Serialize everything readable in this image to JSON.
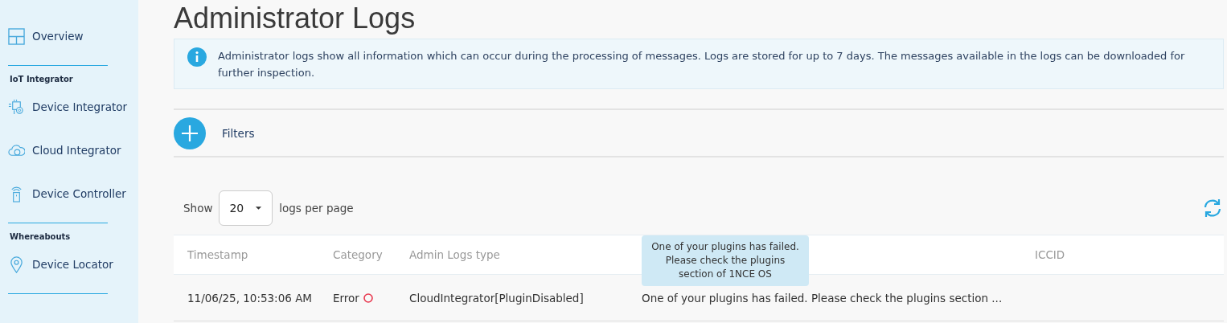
{
  "sidebar": {
    "items": [
      {
        "kind": "link",
        "label": "Overview",
        "selected": false
      },
      {
        "kind": "divider"
      },
      {
        "kind": "section",
        "label": "IoT Integrator"
      },
      {
        "kind": "link",
        "label": "Device Integrator",
        "selected": false
      },
      {
        "kind": "link",
        "label": "Cloud Integrator",
        "selected": false
      },
      {
        "kind": "link",
        "label": "Device Controller",
        "selected": false
      },
      {
        "kind": "divider"
      },
      {
        "kind": "section",
        "label": "Whereabouts"
      },
      {
        "kind": "link",
        "label": "Device Locator",
        "selected": false
      },
      {
        "kind": "divider"
      }
    ]
  },
  "page_title": "Administrator Logs",
  "info": "Administrator logs show all information which can occur during the processing of messages. Logs are stored for up to 7 days. The messages available in the logs can be downloaded for further inspection.",
  "filters": {
    "label": "Filters"
  },
  "pagination": {
    "show": "Show",
    "page_size": "20",
    "suffix": "logs per page"
  },
  "table": {
    "columns": [
      "Timestamp",
      "Category",
      "Admin Logs type",
      "",
      "ICCID"
    ],
    "rows": [
      {
        "timestamp": "11/06/25, 10:53:06 AM",
        "category": "Error",
        "color": "#e8384f",
        "type": "CloudIntegrator[PluginDisabled]",
        "message": "One of your plugins has failed. Please check the plugins section ..."
      }
    ]
  },
  "tooltip": "One of your plugins has failed. Please check the plugins section of 1NCE OS"
}
